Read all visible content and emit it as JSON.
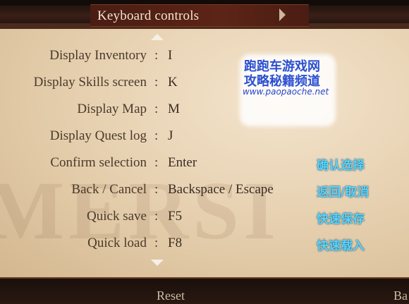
{
  "header": {
    "title": "Keyboard controls"
  },
  "rows": [
    {
      "label": "Display Inventory",
      "sep": ":",
      "value": "I",
      "cn": ""
    },
    {
      "label": "Display Skills screen",
      "sep": ":",
      "value": "K",
      "cn": ""
    },
    {
      "label": "Display Map",
      "sep": ":",
      "value": "M",
      "cn": ""
    },
    {
      "label": "Display Quest log",
      "sep": ":",
      "value": "J",
      "cn": ""
    },
    {
      "label": "Confirm selection",
      "sep": ":",
      "value": "Enter",
      "cn": "确认选择"
    },
    {
      "label": "Back / Cancel",
      "sep": ":",
      "value": "Backspace / Escape",
      "cn": "返回/取消"
    },
    {
      "label": "Quick save",
      "sep": ":",
      "value": "F5",
      "cn": "快速保存"
    },
    {
      "label": "Quick load",
      "sep": ":",
      "value": "F8",
      "cn": "快速载入"
    }
  ],
  "watermark": {
    "line1": "跑跑车游戏网",
    "line2": "攻略秘籍频道",
    "url": "www.paopaoche.net",
    "bg_letters": "MERSI"
  },
  "footer": {
    "left_button": "Reset",
    "right_button": "Ba"
  },
  "colors": {
    "accent_cn": "#55d6ff",
    "title_text": "#f2e6d2"
  },
  "icons": {
    "up": "triangle-up",
    "down": "triangle-down",
    "next": "triangle-right"
  }
}
